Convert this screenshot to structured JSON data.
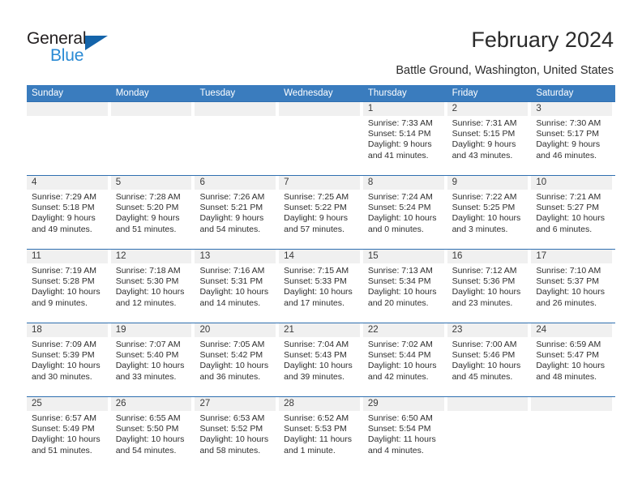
{
  "brand": {
    "name_primary": "General",
    "name_secondary": "Blue"
  },
  "header": {
    "title": "February 2024",
    "location": "Battle Ground, Washington, United States"
  },
  "colors": {
    "header_blue": "#3a7cbe",
    "rule_blue": "#2f6fb0",
    "daynum_band": "#f0f0f0",
    "logo_blue": "#2a8ad4",
    "logo_triangle": "#1464aa"
  },
  "calendar": {
    "day_headers": [
      "Sunday",
      "Monday",
      "Tuesday",
      "Wednesday",
      "Thursday",
      "Friday",
      "Saturday"
    ],
    "weeks": [
      [
        {
          "day": "",
          "sunrise": "",
          "sunset": "",
          "daylight_1": "",
          "daylight_2": ""
        },
        {
          "day": "",
          "sunrise": "",
          "sunset": "",
          "daylight_1": "",
          "daylight_2": ""
        },
        {
          "day": "",
          "sunrise": "",
          "sunset": "",
          "daylight_1": "",
          "daylight_2": ""
        },
        {
          "day": "",
          "sunrise": "",
          "sunset": "",
          "daylight_1": "",
          "daylight_2": ""
        },
        {
          "day": "1",
          "sunrise": "Sunrise: 7:33 AM",
          "sunset": "Sunset: 5:14 PM",
          "daylight_1": "Daylight: 9 hours",
          "daylight_2": "and 41 minutes."
        },
        {
          "day": "2",
          "sunrise": "Sunrise: 7:31 AM",
          "sunset": "Sunset: 5:15 PM",
          "daylight_1": "Daylight: 9 hours",
          "daylight_2": "and 43 minutes."
        },
        {
          "day": "3",
          "sunrise": "Sunrise: 7:30 AM",
          "sunset": "Sunset: 5:17 PM",
          "daylight_1": "Daylight: 9 hours",
          "daylight_2": "and 46 minutes."
        }
      ],
      [
        {
          "day": "4",
          "sunrise": "Sunrise: 7:29 AM",
          "sunset": "Sunset: 5:18 PM",
          "daylight_1": "Daylight: 9 hours",
          "daylight_2": "and 49 minutes."
        },
        {
          "day": "5",
          "sunrise": "Sunrise: 7:28 AM",
          "sunset": "Sunset: 5:20 PM",
          "daylight_1": "Daylight: 9 hours",
          "daylight_2": "and 51 minutes."
        },
        {
          "day": "6",
          "sunrise": "Sunrise: 7:26 AM",
          "sunset": "Sunset: 5:21 PM",
          "daylight_1": "Daylight: 9 hours",
          "daylight_2": "and 54 minutes."
        },
        {
          "day": "7",
          "sunrise": "Sunrise: 7:25 AM",
          "sunset": "Sunset: 5:22 PM",
          "daylight_1": "Daylight: 9 hours",
          "daylight_2": "and 57 minutes."
        },
        {
          "day": "8",
          "sunrise": "Sunrise: 7:24 AM",
          "sunset": "Sunset: 5:24 PM",
          "daylight_1": "Daylight: 10 hours",
          "daylight_2": "and 0 minutes."
        },
        {
          "day": "9",
          "sunrise": "Sunrise: 7:22 AM",
          "sunset": "Sunset: 5:25 PM",
          "daylight_1": "Daylight: 10 hours",
          "daylight_2": "and 3 minutes."
        },
        {
          "day": "10",
          "sunrise": "Sunrise: 7:21 AM",
          "sunset": "Sunset: 5:27 PM",
          "daylight_1": "Daylight: 10 hours",
          "daylight_2": "and 6 minutes."
        }
      ],
      [
        {
          "day": "11",
          "sunrise": "Sunrise: 7:19 AM",
          "sunset": "Sunset: 5:28 PM",
          "daylight_1": "Daylight: 10 hours",
          "daylight_2": "and 9 minutes."
        },
        {
          "day": "12",
          "sunrise": "Sunrise: 7:18 AM",
          "sunset": "Sunset: 5:30 PM",
          "daylight_1": "Daylight: 10 hours",
          "daylight_2": "and 12 minutes."
        },
        {
          "day": "13",
          "sunrise": "Sunrise: 7:16 AM",
          "sunset": "Sunset: 5:31 PM",
          "daylight_1": "Daylight: 10 hours",
          "daylight_2": "and 14 minutes."
        },
        {
          "day": "14",
          "sunrise": "Sunrise: 7:15 AM",
          "sunset": "Sunset: 5:33 PM",
          "daylight_1": "Daylight: 10 hours",
          "daylight_2": "and 17 minutes."
        },
        {
          "day": "15",
          "sunrise": "Sunrise: 7:13 AM",
          "sunset": "Sunset: 5:34 PM",
          "daylight_1": "Daylight: 10 hours",
          "daylight_2": "and 20 minutes."
        },
        {
          "day": "16",
          "sunrise": "Sunrise: 7:12 AM",
          "sunset": "Sunset: 5:36 PM",
          "daylight_1": "Daylight: 10 hours",
          "daylight_2": "and 23 minutes."
        },
        {
          "day": "17",
          "sunrise": "Sunrise: 7:10 AM",
          "sunset": "Sunset: 5:37 PM",
          "daylight_1": "Daylight: 10 hours",
          "daylight_2": "and 26 minutes."
        }
      ],
      [
        {
          "day": "18",
          "sunrise": "Sunrise: 7:09 AM",
          "sunset": "Sunset: 5:39 PM",
          "daylight_1": "Daylight: 10 hours",
          "daylight_2": "and 30 minutes."
        },
        {
          "day": "19",
          "sunrise": "Sunrise: 7:07 AM",
          "sunset": "Sunset: 5:40 PM",
          "daylight_1": "Daylight: 10 hours",
          "daylight_2": "and 33 minutes."
        },
        {
          "day": "20",
          "sunrise": "Sunrise: 7:05 AM",
          "sunset": "Sunset: 5:42 PM",
          "daylight_1": "Daylight: 10 hours",
          "daylight_2": "and 36 minutes."
        },
        {
          "day": "21",
          "sunrise": "Sunrise: 7:04 AM",
          "sunset": "Sunset: 5:43 PM",
          "daylight_1": "Daylight: 10 hours",
          "daylight_2": "and 39 minutes."
        },
        {
          "day": "22",
          "sunrise": "Sunrise: 7:02 AM",
          "sunset": "Sunset: 5:44 PM",
          "daylight_1": "Daylight: 10 hours",
          "daylight_2": "and 42 minutes."
        },
        {
          "day": "23",
          "sunrise": "Sunrise: 7:00 AM",
          "sunset": "Sunset: 5:46 PM",
          "daylight_1": "Daylight: 10 hours",
          "daylight_2": "and 45 minutes."
        },
        {
          "day": "24",
          "sunrise": "Sunrise: 6:59 AM",
          "sunset": "Sunset: 5:47 PM",
          "daylight_1": "Daylight: 10 hours",
          "daylight_2": "and 48 minutes."
        }
      ],
      [
        {
          "day": "25",
          "sunrise": "Sunrise: 6:57 AM",
          "sunset": "Sunset: 5:49 PM",
          "daylight_1": "Daylight: 10 hours",
          "daylight_2": "and 51 minutes."
        },
        {
          "day": "26",
          "sunrise": "Sunrise: 6:55 AM",
          "sunset": "Sunset: 5:50 PM",
          "daylight_1": "Daylight: 10 hours",
          "daylight_2": "and 54 minutes."
        },
        {
          "day": "27",
          "sunrise": "Sunrise: 6:53 AM",
          "sunset": "Sunset: 5:52 PM",
          "daylight_1": "Daylight: 10 hours",
          "daylight_2": "and 58 minutes."
        },
        {
          "day": "28",
          "sunrise": "Sunrise: 6:52 AM",
          "sunset": "Sunset: 5:53 PM",
          "daylight_1": "Daylight: 11 hours",
          "daylight_2": "and 1 minute."
        },
        {
          "day": "29",
          "sunrise": "Sunrise: 6:50 AM",
          "sunset": "Sunset: 5:54 PM",
          "daylight_1": "Daylight: 11 hours",
          "daylight_2": "and 4 minutes."
        },
        {
          "day": "",
          "sunrise": "",
          "sunset": "",
          "daylight_1": "",
          "daylight_2": ""
        },
        {
          "day": "",
          "sunrise": "",
          "sunset": "",
          "daylight_1": "",
          "daylight_2": ""
        }
      ]
    ]
  }
}
